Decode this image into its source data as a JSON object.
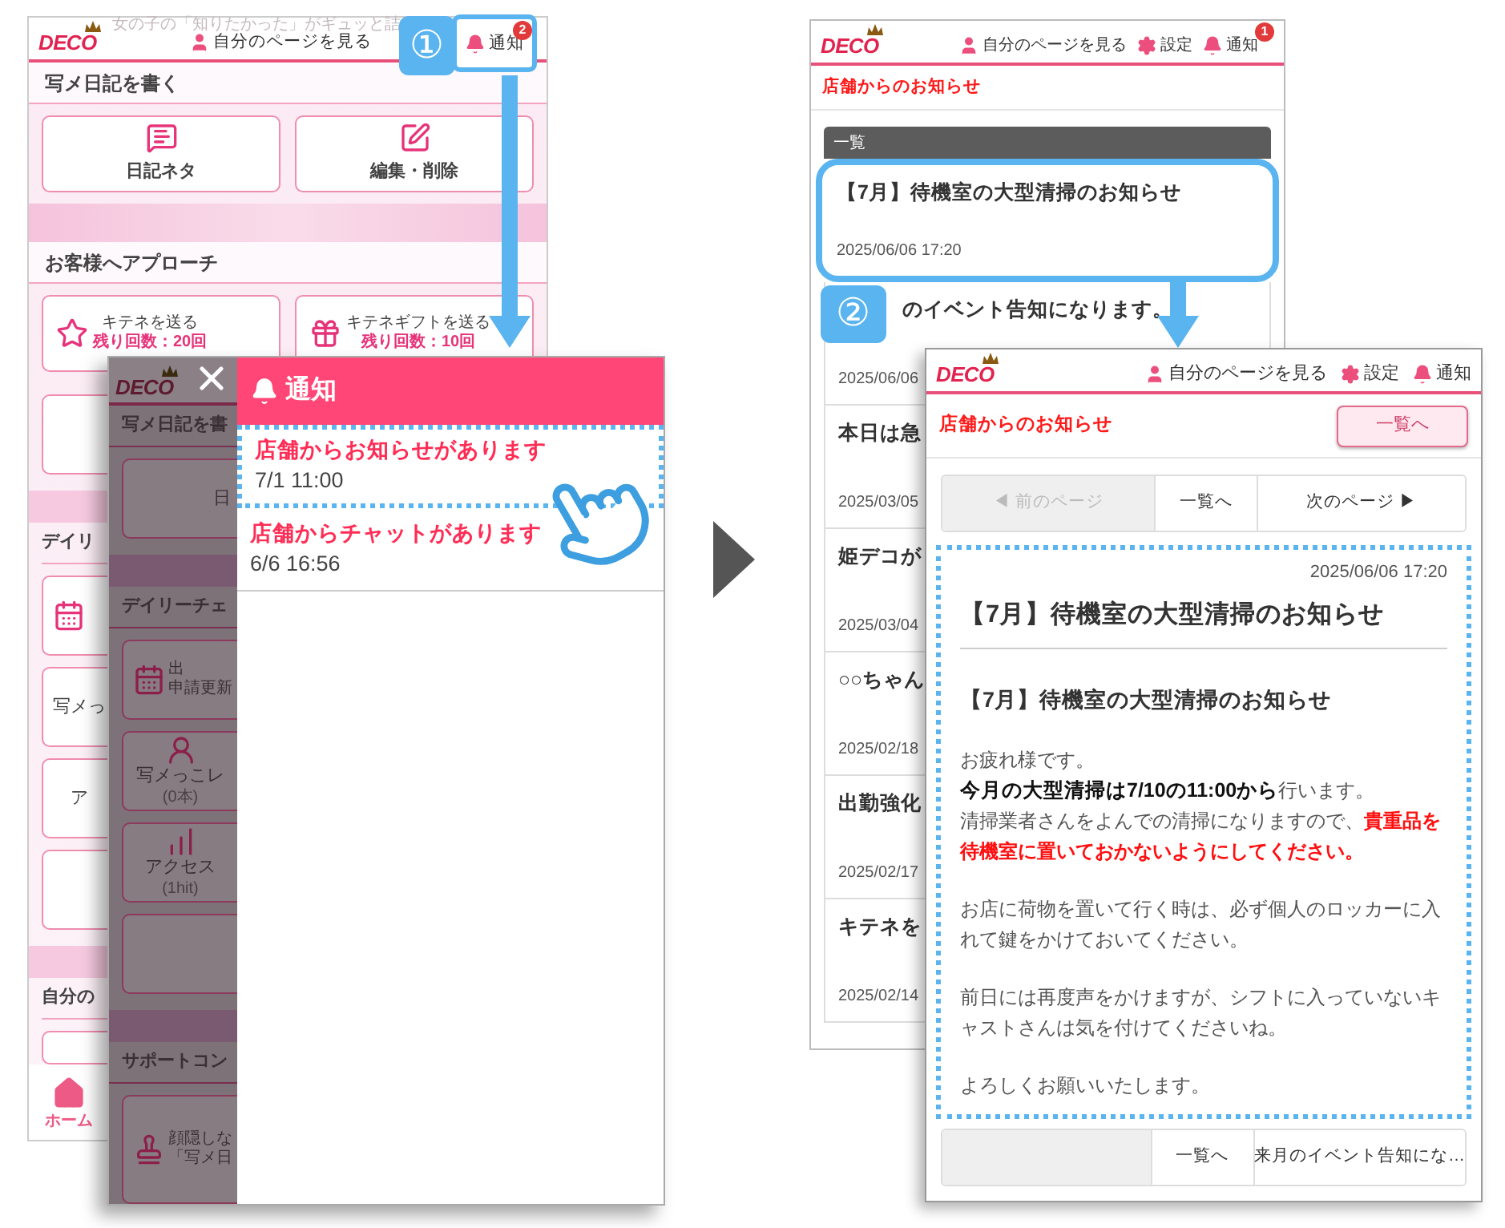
{
  "guide_steps": [
    {
      "label": "①"
    },
    {
      "label": "②"
    }
  ],
  "home_screen": {
    "logo": "DECO",
    "tagline": "女の子の「知りたかった」がギュッと詰",
    "header_links": [
      {
        "label": "自分のページを見る",
        "highlighted": false
      },
      {
        "label": "通知",
        "badge": "2",
        "highlighted": true
      }
    ],
    "sections": [
      {
        "title": "写メ日記を書く",
        "buttons": [
          {
            "label": "日記ネタ"
          },
          {
            "label": "編集・削除"
          }
        ]
      },
      {
        "title": "お客様へアプローチ",
        "buttons": [
          {
            "label": "キテネを送る",
            "sub": "残り回数：20回"
          },
          {
            "label": "キテネギフトを送る",
            "sub": "残り回数：10回"
          }
        ]
      }
    ],
    "lower_strip": [
      {
        "kind": "button"
      },
      {
        "kind": "band"
      },
      {
        "kind": "title",
        "label": "デイリ"
      },
      {
        "kind": "calendar"
      },
      {
        "kind": "button",
        "label": "写メっ"
      },
      {
        "kind": "button",
        "label": "ア"
      },
      {
        "kind": "button"
      },
      {
        "kind": "band"
      },
      {
        "kind": "title",
        "label": "自分の"
      },
      {
        "kind": "button"
      }
    ],
    "bottom_nav": {
      "label": "ホーム"
    }
  },
  "drawer_screen": {
    "logo": "DECO",
    "dim_items": [
      {
        "kind": "title",
        "label": "写メ日記を書"
      },
      {
        "kind": "button",
        "label": "日"
      },
      {
        "kind": "band"
      },
      {
        "kind": "title",
        "label": "デイリーチェ"
      },
      {
        "kind": "calendar",
        "label": "出",
        "sub": "申請更新"
      },
      {
        "kind": "avatar",
        "label": "写メっこレ",
        "sub": "(0本)"
      },
      {
        "kind": "chart",
        "label": "アクセス",
        "sub": "(1hit)"
      },
      {
        "kind": "button"
      },
      {
        "kind": "band"
      },
      {
        "kind": "title",
        "label": "サポートコン"
      },
      {
        "kind": "stamp",
        "label": "顔隠しな",
        "sub": "「写メ日"
      }
    ],
    "title": "通知",
    "items": [
      {
        "title": "店舗からお知らせがあります",
        "time": "7/1 11:00",
        "highlighted": true
      },
      {
        "title": "店舗からチャットがあります",
        "time": "6/6 16:56",
        "highlighted": false
      }
    ]
  },
  "list_screen": {
    "logo": "DECO",
    "header_links": [
      {
        "label": "自分のページを見る"
      },
      {
        "label": "設定"
      },
      {
        "label": "通知",
        "badge": "1"
      }
    ],
    "page_title": "店舗からのお知らせ",
    "list_header": "一覧",
    "items": [
      {
        "title": "【7月】待機室の大型清掃のお知らせ",
        "date": "2025/06/06 17:20",
        "highlighted": true
      },
      {
        "title": "のイベント告知になります。",
        "date": "2025/06/06",
        "highlighted": false
      },
      {
        "title": "本日は急",
        "date": "2025/03/05",
        "highlighted": false
      },
      {
        "title": "姫デコが",
        "date": "2025/03/04",
        "highlighted": false
      },
      {
        "title": "○○ちゃん",
        "date": "2025/02/18",
        "highlighted": false
      },
      {
        "title": "出勤強化",
        "date": "2025/02/17",
        "highlighted": false
      },
      {
        "title": "キテネを",
        "date": "2025/02/14",
        "highlighted": false
      }
    ]
  },
  "detail_screen": {
    "logo": "DECO",
    "header_links": [
      {
        "label": "自分のページを見る"
      },
      {
        "label": "設定"
      },
      {
        "label": "通知"
      }
    ],
    "page_title": "店舗からのお知らせ",
    "back_button": "一覧へ",
    "pager_top": [
      {
        "label": "◀ 前のページ",
        "disabled": true
      },
      {
        "label": "一覧へ",
        "disabled": false
      },
      {
        "label": "次のページ ▶",
        "disabled": false
      }
    ],
    "article": {
      "date": "2025/06/06 17:20",
      "title": "【7月】待機室の大型清掃のお知らせ",
      "heading": "【7月】待機室の大型清掃のお知らせ",
      "body": [
        {
          "lines": [
            [
              {
                "kind": "plain",
                "text": "お疲れ様です。"
              }
            ],
            [
              {
                "kind": "bold",
                "text": "今月の大型清掃は7/10の11:00から"
              },
              {
                "kind": "plain",
                "text": "行います。"
              }
            ],
            [
              {
                "kind": "plain",
                "text": "清掃業者さんをよんでの清掃になりますので、"
              },
              {
                "kind": "alert",
                "text": "貴重品を待機室に置いておかないようにしてください。"
              }
            ]
          ]
        },
        {
          "lines": [
            [
              {
                "kind": "plain",
                "text": "お店に荷物を置いて行く時は、必ず個人のロッカーに入れて鍵をかけておいてください。"
              }
            ]
          ]
        },
        {
          "lines": [
            [
              {
                "kind": "plain",
                "text": "前日には再度声をかけますが、シフトに入っていないキャストさんは気を付けてくださいね。"
              }
            ]
          ]
        },
        {
          "lines": [
            [
              {
                "kind": "plain",
                "text": "よろしくお願いいたします。"
              }
            ]
          ]
        }
      ]
    },
    "pager_bottom": [
      {
        "disabled": true
      },
      {
        "label": "一覧へ",
        "disabled": false
      },
      {
        "label": "来月のイベント告知にな…",
        "disabled": false
      }
    ]
  }
}
